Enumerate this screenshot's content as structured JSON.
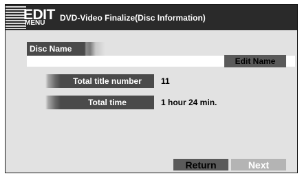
{
  "header": {
    "edit": "EDIT",
    "menu": "MENU",
    "title": "DVD-Video Finalize(Disc Information)"
  },
  "disc_name": {
    "label": "Disc Name",
    "value": "",
    "edit_button": "Edit Name"
  },
  "info": {
    "title_number_label": "Total title number",
    "title_number_value": "11",
    "total_time_label": "Total time",
    "total_time_value": "1 hour 24 min."
  },
  "footer": {
    "return_label": "Return",
    "next_label": "Next"
  },
  "icons": {
    "menu_icon": "striped-edit-menu-icon"
  },
  "colors": {
    "panel_bg": "#e2e2e2",
    "header_bg": "#2a2a2a",
    "label_bg": "#4a4a4a",
    "active_button": "#5a5a5a",
    "disabled_button": "#b4b4b4"
  }
}
